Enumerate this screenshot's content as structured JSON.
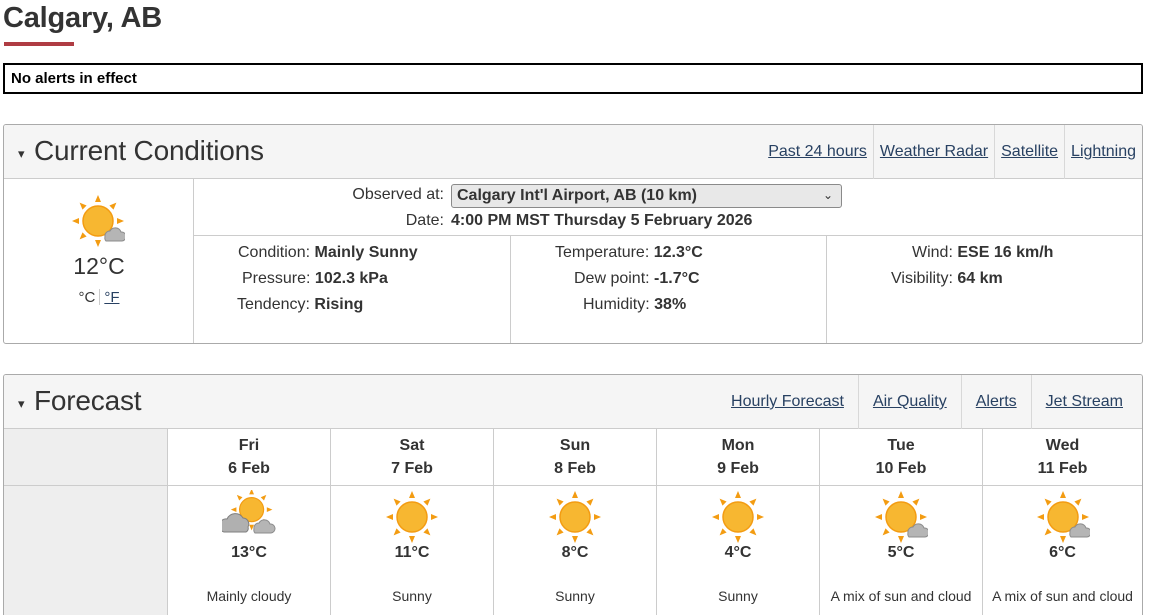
{
  "header": {
    "city": "Calgary, AB"
  },
  "alerts": {
    "text": "No alerts in effect"
  },
  "current": {
    "title": "Current Conditions",
    "links": [
      "Past 24 hours",
      "Weather Radar",
      "Satellite",
      "Lightning"
    ],
    "temp": "12°C",
    "unit_c": "°C",
    "unit_f": "°F",
    "icon": "sun-with-cloud-icon",
    "observed_label": "Observed at:",
    "observed_value": "Calgary Int'l Airport, AB (10 km)",
    "date_label": "Date:",
    "date_value": "4:00 PM MST Thursday 5 February 2026",
    "condition_label": "Condition:",
    "condition_value": "Mainly Sunny",
    "pressure_label": "Pressure:",
    "pressure_value": "102.3 kPa",
    "tendency_label": "Tendency:",
    "tendency_value": "Rising",
    "temperature_label": "Temperature:",
    "temperature_value": "12.3°C",
    "dewpoint_label": "Dew point:",
    "dewpoint_value": "-1.7°C",
    "humidity_label": "Humidity:",
    "humidity_value": "38%",
    "wind_label": "Wind:",
    "wind_value": "ESE 16 km/h",
    "visibility_label": "Visibility:",
    "visibility_value": "64 km"
  },
  "forecast": {
    "title": "Forecast",
    "links": [
      "Hourly Forecast",
      "Air Quality",
      "Alerts",
      "Jet Stream"
    ],
    "days": [
      {
        "day": "Fri",
        "date": "6 Feb",
        "temp": "13°C",
        "cond": "Mainly cloudy",
        "icon": "mostly-cloudy-icon"
      },
      {
        "day": "Sat",
        "date": "7 Feb",
        "temp": "11°C",
        "cond": "Sunny",
        "icon": "sun-icon"
      },
      {
        "day": "Sun",
        "date": "8 Feb",
        "temp": "8°C",
        "cond": "Sunny",
        "icon": "sun-icon"
      },
      {
        "day": "Mon",
        "date": "9 Feb",
        "temp": "4°C",
        "cond": "Sunny",
        "icon": "sun-icon"
      },
      {
        "day": "Tue",
        "date": "10 Feb",
        "temp": "5°C",
        "cond": "A mix of sun and cloud",
        "icon": "sun-with-cloud-icon"
      },
      {
        "day": "Wed",
        "date": "11 Feb",
        "temp": "6°C",
        "cond": "A mix of sun and cloud",
        "icon": "sun-with-cloud-icon"
      }
    ]
  },
  "colors": {
    "accent_rule": "#af3c43",
    "link": "#284162",
    "sun": "#f7b731",
    "sun_rays": "#f39c12",
    "cloud": "#a9a9a9"
  }
}
